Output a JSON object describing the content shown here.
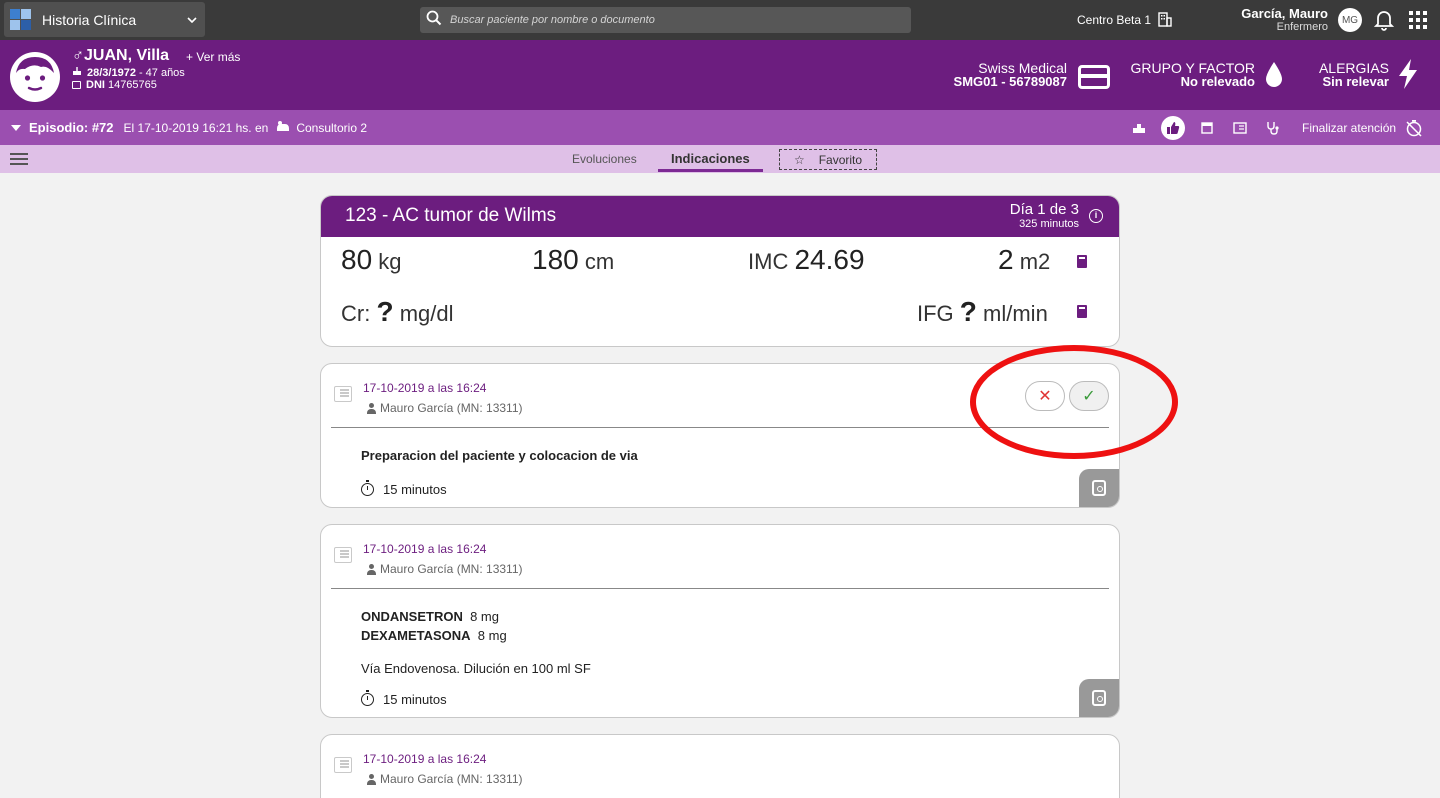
{
  "topbar": {
    "app_name": "Historia Clínica",
    "search_placeholder": "Buscar paciente por nombre o documento",
    "center_name": "Centro Beta 1",
    "user_name": "García, Mauro",
    "user_role": "Enfermero",
    "user_initials": "MG"
  },
  "patient": {
    "sex_symbol": "♂",
    "name": "JUAN, Villa",
    "more_label": "Ver más",
    "birth_date": "28/3/1972",
    "age": "- 47 años",
    "doc_label": "DNI",
    "doc_number": "14765765",
    "insurance": "Swiss Medical",
    "insurance_id": "SMG01 - 56789087",
    "blood_label": "GRUPO Y FACTOR",
    "blood_value": "No relevado",
    "allergies_label": "ALERGIAS",
    "allergies_value": "Sin relevar"
  },
  "episode": {
    "title": "Episodio: #72",
    "when": "El 17-10-2019 16:21 hs. en",
    "place": "Consultorio 2",
    "finish_label": "Finalizar atención"
  },
  "tabs": {
    "evoluciones": "Evoluciones",
    "indicaciones": "Indicaciones",
    "favorito": "Favorito"
  },
  "summary": {
    "code": "123 -",
    "diagnosis": "AC tumor de Wilms",
    "day": "Día 1 de 3",
    "minutes": "325 minutos",
    "info_glyph": "i",
    "weight_value": "80",
    "weight_unit": "kg",
    "height_value": "180",
    "height_unit": "cm",
    "imc_label": "IMC",
    "imc_value": "24.69",
    "bsa_value": "2",
    "bsa_unit": "m2",
    "cr_label": "Cr:",
    "cr_value": "?",
    "cr_unit": "mg/dl",
    "ifg_label": "IFG",
    "ifg_value": "?",
    "ifg_unit": "ml/min"
  },
  "indications": [
    {
      "date": "17-10-2019 a las 16:24",
      "author": "Mauro García (MN: 13311)",
      "text": "Preparacion del paciente y colocacion de via",
      "duration": "15 minutos",
      "reject_glyph": "✕",
      "accept_glyph": "✓"
    },
    {
      "date": "17-10-2019 a las 16:24",
      "author": "Mauro García (MN: 13311)",
      "drug1_name": "ONDANSETRON",
      "drug1_dose": "8 mg",
      "drug2_name": "DEXAMETASONA",
      "drug2_dose": "8 mg",
      "route": "Vía Endovenosa. Dilución en 100 ml SF",
      "duration": "15 minutos"
    },
    {
      "date": "17-10-2019 a las 16:24",
      "author": "Mauro García (MN: 13311)"
    }
  ],
  "colors": {
    "brand_purple": "#6c1d7f",
    "episode_purple": "#9b4fb0",
    "tabs_lilac": "#dfc0e7",
    "topbar": "#3a3a3a",
    "highlight_red": "#ee1111"
  }
}
